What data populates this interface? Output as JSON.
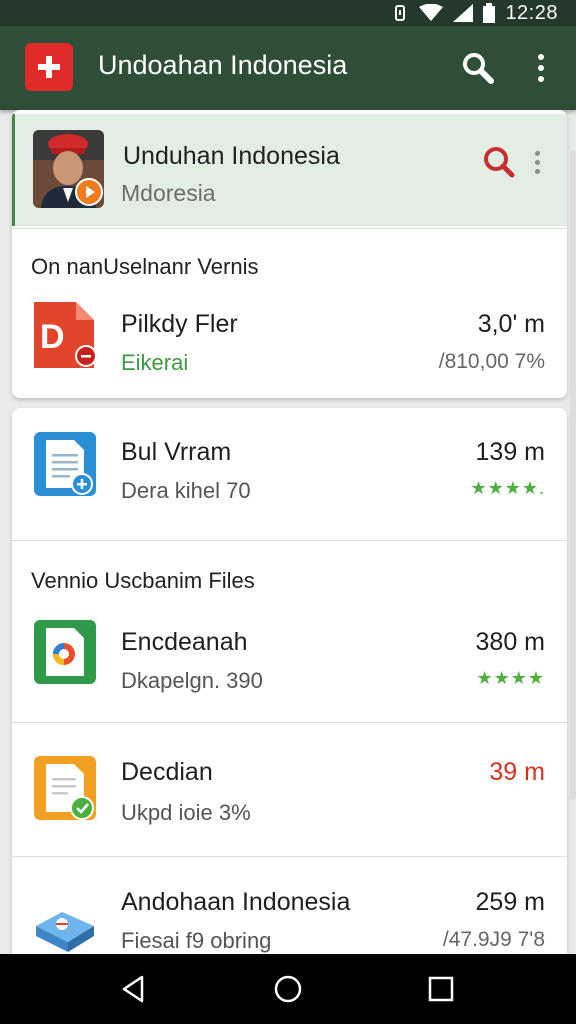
{
  "status_bar": {
    "time": "12:28"
  },
  "app_bar": {
    "title": "Undoahan Indonesia"
  },
  "featured": {
    "title": "Unduhan Indonesia",
    "subtitle": "Mdoresia"
  },
  "sections": [
    {
      "header": "On nanUselnanr Vernis"
    },
    {
      "header": "Vennio Uscbanim Files"
    }
  ],
  "items": [
    {
      "title": "Pilkdy Fler",
      "subtitle": "Eikerai",
      "size": "3,0' m",
      "meta": "/810,00 7%"
    },
    {
      "title": "Bul Vrram",
      "subtitle": "Dera kihel 70",
      "size": "139 m",
      "rating": "★★★★."
    },
    {
      "title": "Encdeanah",
      "subtitle": "Dkapelgn. 390",
      "size": "380 m",
      "rating": "★★★★"
    },
    {
      "title": "Decdian",
      "subtitle": "Ukpd ioie 3%",
      "size": "39 m"
    },
    {
      "title": "Andohaan Indonesia",
      "subtitle": "Fiesai f9 obring",
      "size": "259 m",
      "meta": "/47.9J9 7'8"
    }
  ],
  "colors": {
    "app_bar": "#2e4e38",
    "accent_green": "#3f9a3f",
    "accent_red": "#d7301f"
  }
}
